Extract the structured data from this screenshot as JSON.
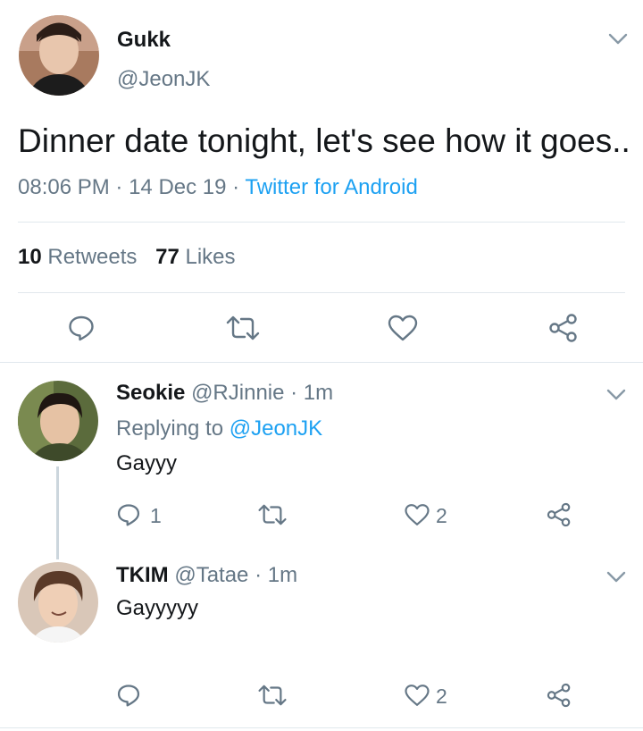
{
  "main_tweet": {
    "display_name": "Gukk",
    "handle": "@JeonJK",
    "text": "Dinner date tonight, let's see how it goes..",
    "time": "08:06 PM",
    "sep1": "·",
    "date": "14 Dec 19",
    "sep2": "·",
    "source": "Twitter for Android",
    "retweets_count": "10",
    "retweets_label": "Retweets",
    "likes_count": "77",
    "likes_label": "Likes"
  },
  "replies": [
    {
      "display_name": "Seokie",
      "handle": "@RJinnie",
      "age": "· 1m",
      "replying_label": "Replying to",
      "replying_handle": "@JeonJK",
      "text": "Gayyy",
      "reply_count": "1",
      "like_count": "2"
    },
    {
      "display_name": "TKIM",
      "handle": "@Tatae",
      "age": "· 1m",
      "text": "Gayyyyy",
      "like_count": "2"
    }
  ],
  "colors": {
    "accent": "#1da1f2",
    "secondary_text": "#657786",
    "divider": "#e1e8ed"
  },
  "icons": [
    "reply-icon",
    "retweet-icon",
    "like-icon",
    "share-icon",
    "chevron-down-icon"
  ]
}
